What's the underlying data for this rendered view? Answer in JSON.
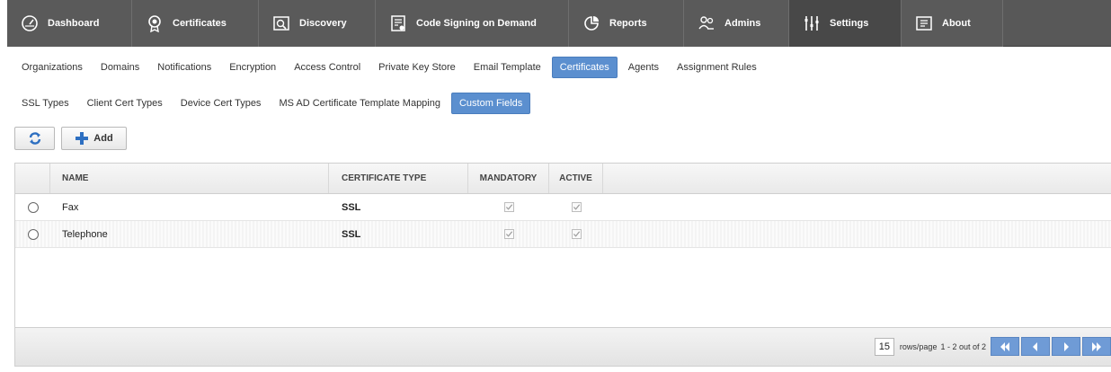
{
  "nav": {
    "items": [
      {
        "label": "Dashboard",
        "icon": "gauge-icon"
      },
      {
        "label": "Certificates",
        "icon": "certificate-icon"
      },
      {
        "label": "Discovery",
        "icon": "discovery-icon"
      },
      {
        "label": "Code Signing on Demand",
        "icon": "code-signing-icon"
      },
      {
        "label": "Reports",
        "icon": "reports-icon"
      },
      {
        "label": "Admins",
        "icon": "admins-icon"
      },
      {
        "label": "Settings",
        "icon": "settings-icon"
      },
      {
        "label": "About",
        "icon": "about-icon"
      }
    ],
    "active": "Settings"
  },
  "settings_tabs": [
    "Organizations",
    "Domains",
    "Notifications",
    "Encryption",
    "Access Control",
    "Private Key Store",
    "Email Template",
    "Certificates",
    "Agents",
    "Assignment Rules"
  ],
  "certificate_tabs": [
    "SSL Types",
    "Client Cert Types",
    "Device Cert Types",
    "MS AD Certificate Template Mapping",
    "Custom Fields"
  ],
  "toolbar": {
    "refresh_icon": "refresh-icon",
    "add_label": "Add"
  },
  "grid": {
    "columns": {
      "name": "NAME",
      "type": "CERTIFICATE TYPE",
      "mandatory": "MANDATORY",
      "active": "ACTIVE"
    },
    "rows": [
      {
        "name": "Fax",
        "type": "SSL",
        "mandatory": true,
        "active": true
      },
      {
        "name": "Telephone",
        "type": "SSL",
        "mandatory": true,
        "active": true
      }
    ]
  },
  "pager": {
    "rows_per_page": "15",
    "rows_label": "rows/page",
    "range": "1 - 2 out of 2"
  },
  "colors": {
    "nav_bg": "#585858",
    "accent": "#5b8fcf",
    "pager_button": "#6f9bd6"
  }
}
